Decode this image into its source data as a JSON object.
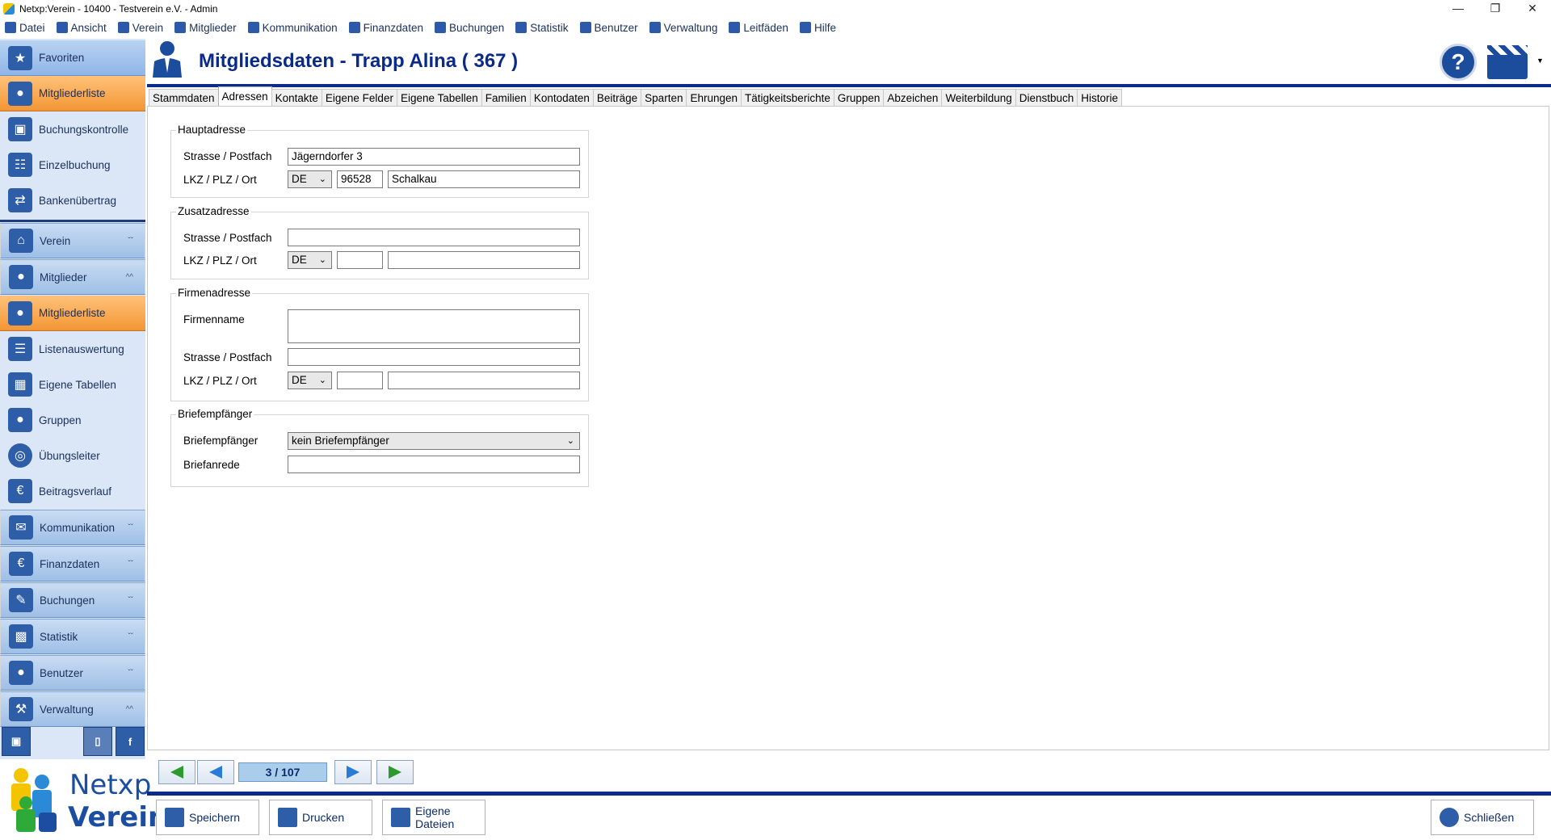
{
  "window": {
    "title": "Netxp:Verein - 10400 - Testverein e.V. - Admin"
  },
  "menu": [
    "Datei",
    "Ansicht",
    "Verein",
    "Mitglieder",
    "Kommunikation",
    "Finanzdaten",
    "Buchungen",
    "Statistik",
    "Benutzer",
    "Verwaltung",
    "Leitfäden",
    "Hilfe"
  ],
  "sidebar": {
    "favoriten": "Favoriten",
    "fav_items": [
      "Mitgliederliste",
      "Buchungskontrolle",
      "Einzelbuchung",
      "Bankenübertrag"
    ],
    "groups": {
      "verein": "Verein",
      "mitglieder": "Mitglieder",
      "kommunikation": "Kommunikation",
      "finanzdaten": "Finanzdaten",
      "buchungen": "Buchungen",
      "statistik": "Statistik",
      "benutzer": "Benutzer",
      "verwaltung": "Verwaltung"
    },
    "mitglieder_items": [
      "Mitgliederliste",
      "Listenauswertung",
      "Eigene Tabellen",
      "Gruppen",
      "Übungsleiter",
      "Beitragsverlauf"
    ]
  },
  "logo": {
    "line1": "Netxp",
    "line2": "Verein"
  },
  "header": {
    "title": "Mitgliedsdaten - Trapp Alina ( 367 )"
  },
  "tabs": [
    "Stammdaten",
    "Adressen",
    "Kontakte",
    "Eigene Felder",
    "Eigene Tabellen",
    "Familien",
    "Kontodaten",
    "Beiträge",
    "Sparten",
    "Ehrungen",
    "Tätigkeitsberichte",
    "Gruppen",
    "Abzeichen",
    "Weiterbildung",
    "Dienstbuch",
    "Historie"
  ],
  "form": {
    "haupt": {
      "legend": "Hauptadresse",
      "strasse_label": "Strasse / Postfach",
      "strasse": "Jägerndorfer 3",
      "lkz_label": "LKZ / PLZ / Ort",
      "lkz": "DE",
      "plz": "96528",
      "ort": "Schalkau"
    },
    "zusatz": {
      "legend": "Zusatzadresse",
      "strasse_label": "Strasse / Postfach",
      "strasse": "",
      "lkz_label": "LKZ / PLZ / Ort",
      "lkz": "DE",
      "plz": "",
      "ort": ""
    },
    "firma": {
      "legend": "Firmenadresse",
      "name_label": "Firmenname",
      "name": "",
      "strasse_label": "Strasse / Postfach",
      "strasse": "",
      "lkz_label": "LKZ / PLZ / Ort",
      "lkz": "DE",
      "plz": "",
      "ort": ""
    },
    "brief": {
      "legend": "Briefempfänger",
      "empf_label": "Briefempfänger",
      "empf": "kein Briefempfänger",
      "anrede_label": "Briefanrede",
      "anrede": ""
    }
  },
  "nav": {
    "counter": "3 / 107"
  },
  "footer": {
    "save": "Speichern",
    "print": "Drucken",
    "files_line1": "Eigene",
    "files_line2": "Dateien",
    "close": "Schließen"
  }
}
